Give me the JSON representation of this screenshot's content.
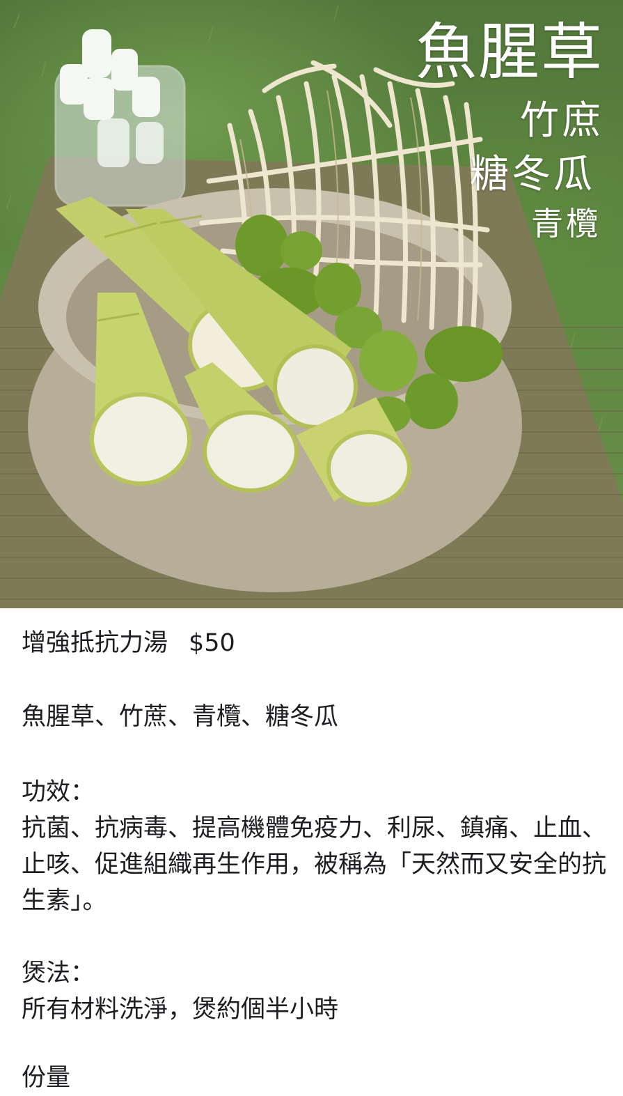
{
  "photo": {
    "overlay_lines": [
      "魚腥草",
      "竹庶",
      "糖冬瓜",
      "青欖"
    ],
    "alt": "魚腥草 竹庶 糖冬瓜 青欖"
  },
  "post": {
    "title": "增強抵抗力湯",
    "price": "$50",
    "ingredients": "魚腥草、竹蔗、青欖、糖冬瓜",
    "effects_label": "功效：",
    "effects_text": "抗菌、抗病毒、提高機體免疫力、利尿、鎮痛、止血、止咳、促進組織再生作用，被稱為「天然而又安全的抗生素」。",
    "method_label": "煲法：",
    "method_text": "所有材料洗淨，煲約個半小時",
    "next_line_partial": "份量"
  },
  "colors": {
    "text": "#1c1e21",
    "background": "#ffffff",
    "overlay_text": "#ffffff"
  }
}
